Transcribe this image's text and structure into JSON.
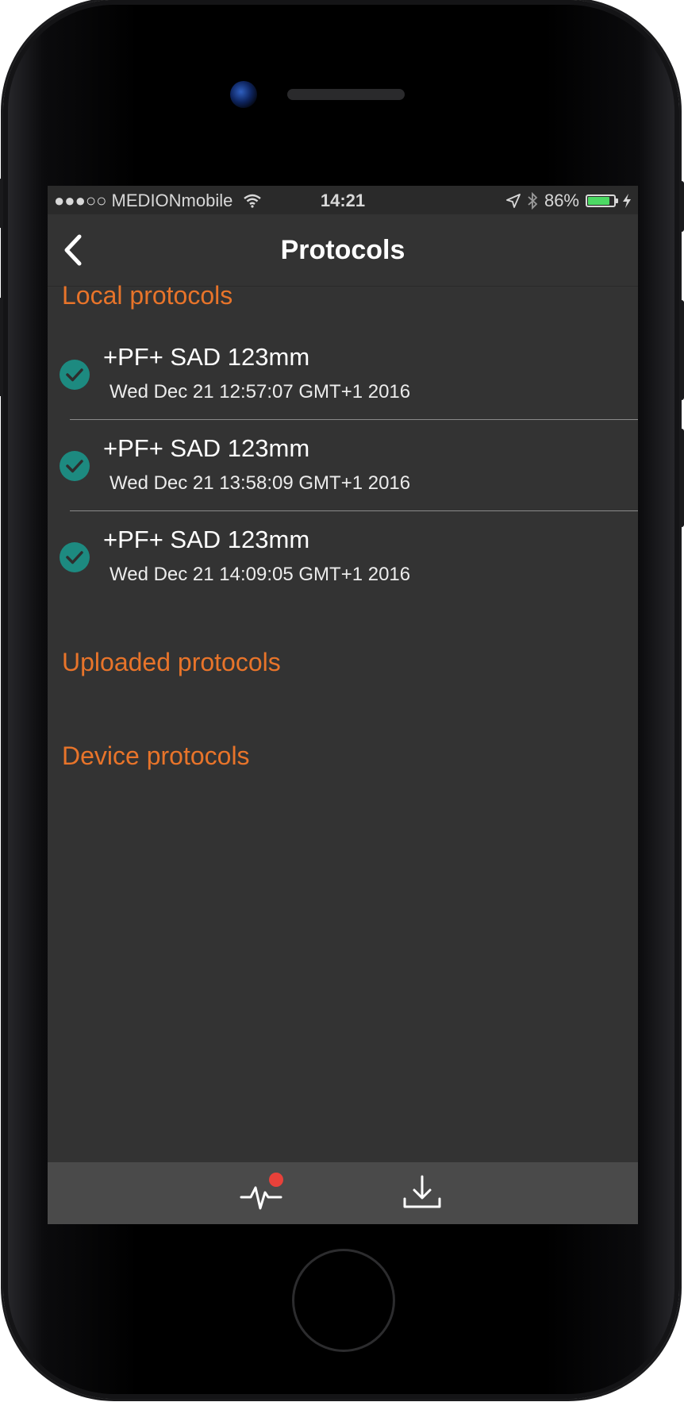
{
  "status_bar": {
    "carrier": "●●●○○ MEDIONmobile",
    "time": "14:21",
    "battery_percent": "86%",
    "battery_level": 0.86,
    "battery_color": "#4cd964"
  },
  "nav": {
    "title": "Protocols",
    "back_icon": "chevron-left-icon"
  },
  "sections": {
    "local": {
      "label": "Local protocols"
    },
    "uploaded": {
      "label": "Uploaded protocols"
    },
    "device": {
      "label": "Device protocols"
    }
  },
  "local_items": [
    {
      "title": "+PF+ SAD 123mm",
      "subtitle": "Wed Dec 21 12:57:07 GMT+1 2016",
      "status_icon": "check-circle-icon"
    },
    {
      "title": "+PF+ SAD 123mm",
      "subtitle": "Wed Dec 21 13:58:09 GMT+1 2016",
      "status_icon": "check-circle-icon"
    },
    {
      "title": "+PF+ SAD 123mm",
      "subtitle": "Wed Dec 21 14:09:05 GMT+1 2016",
      "status_icon": "check-circle-icon"
    }
  ],
  "tab_bar": {
    "tabs": [
      {
        "icon": "pulse-icon",
        "badge": true,
        "badge_color": "#e8413a"
      },
      {
        "icon": "download-icon",
        "badge": false
      }
    ]
  },
  "colors": {
    "accent": "#e8742a",
    "check": "#1d8a80",
    "screen_bg": "#333333",
    "tab_bg": "#4a4a4a"
  }
}
